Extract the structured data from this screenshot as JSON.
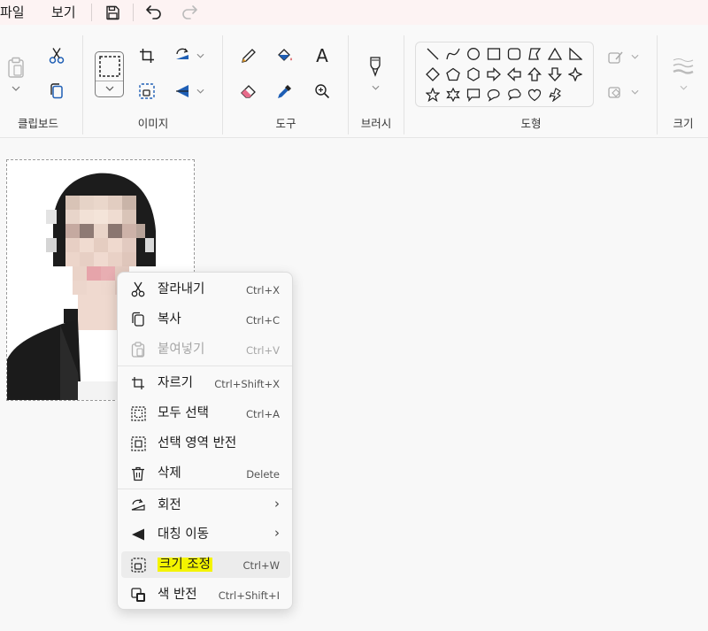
{
  "menubar": {
    "file": "파일",
    "view": "보기"
  },
  "ribbon": {
    "groups": {
      "clipboard": "클립보드",
      "image": "이미지",
      "tools": "도구",
      "brush": "브러시",
      "shapes": "도형",
      "size": "크기"
    }
  },
  "context_menu": {
    "items": [
      {
        "label": "잘라내기",
        "shortcut": "Ctrl+X",
        "icon": "scissors-icon",
        "enabled": true
      },
      {
        "label": "복사",
        "shortcut": "Ctrl+C",
        "icon": "copy-icon",
        "enabled": true
      },
      {
        "label": "붙여넣기",
        "shortcut": "Ctrl+V",
        "icon": "paste-icon",
        "enabled": false
      },
      {
        "label": "자르기",
        "shortcut": "Ctrl+Shift+X",
        "icon": "crop-icon",
        "enabled": true
      },
      {
        "label": "모두 선택",
        "shortcut": "Ctrl+A",
        "icon": "select-all-icon",
        "enabled": true
      },
      {
        "label": "선택 영역 반전",
        "shortcut": "",
        "icon": "invert-selection-icon",
        "enabled": true
      },
      {
        "label": "삭제",
        "shortcut": "Delete",
        "icon": "trash-icon",
        "enabled": true
      },
      {
        "label": "회전",
        "shortcut": "",
        "icon": "rotate-icon",
        "enabled": true,
        "submenu": true
      },
      {
        "label": "대칭 이동",
        "shortcut": "",
        "icon": "flip-icon",
        "enabled": true,
        "submenu": true
      },
      {
        "label": "크기 조정",
        "shortcut": "Ctrl+W",
        "icon": "resize-icon",
        "enabled": true
      },
      {
        "label": "색 반전",
        "shortcut": "Ctrl+Shift+I",
        "icon": "invert-colors-icon",
        "enabled": true
      }
    ],
    "submenu_arrow": "›"
  },
  "colors": {
    "highlight": "#f4f400",
    "accent_blue": "#1f5fb5",
    "accent_red": "#d13438"
  }
}
